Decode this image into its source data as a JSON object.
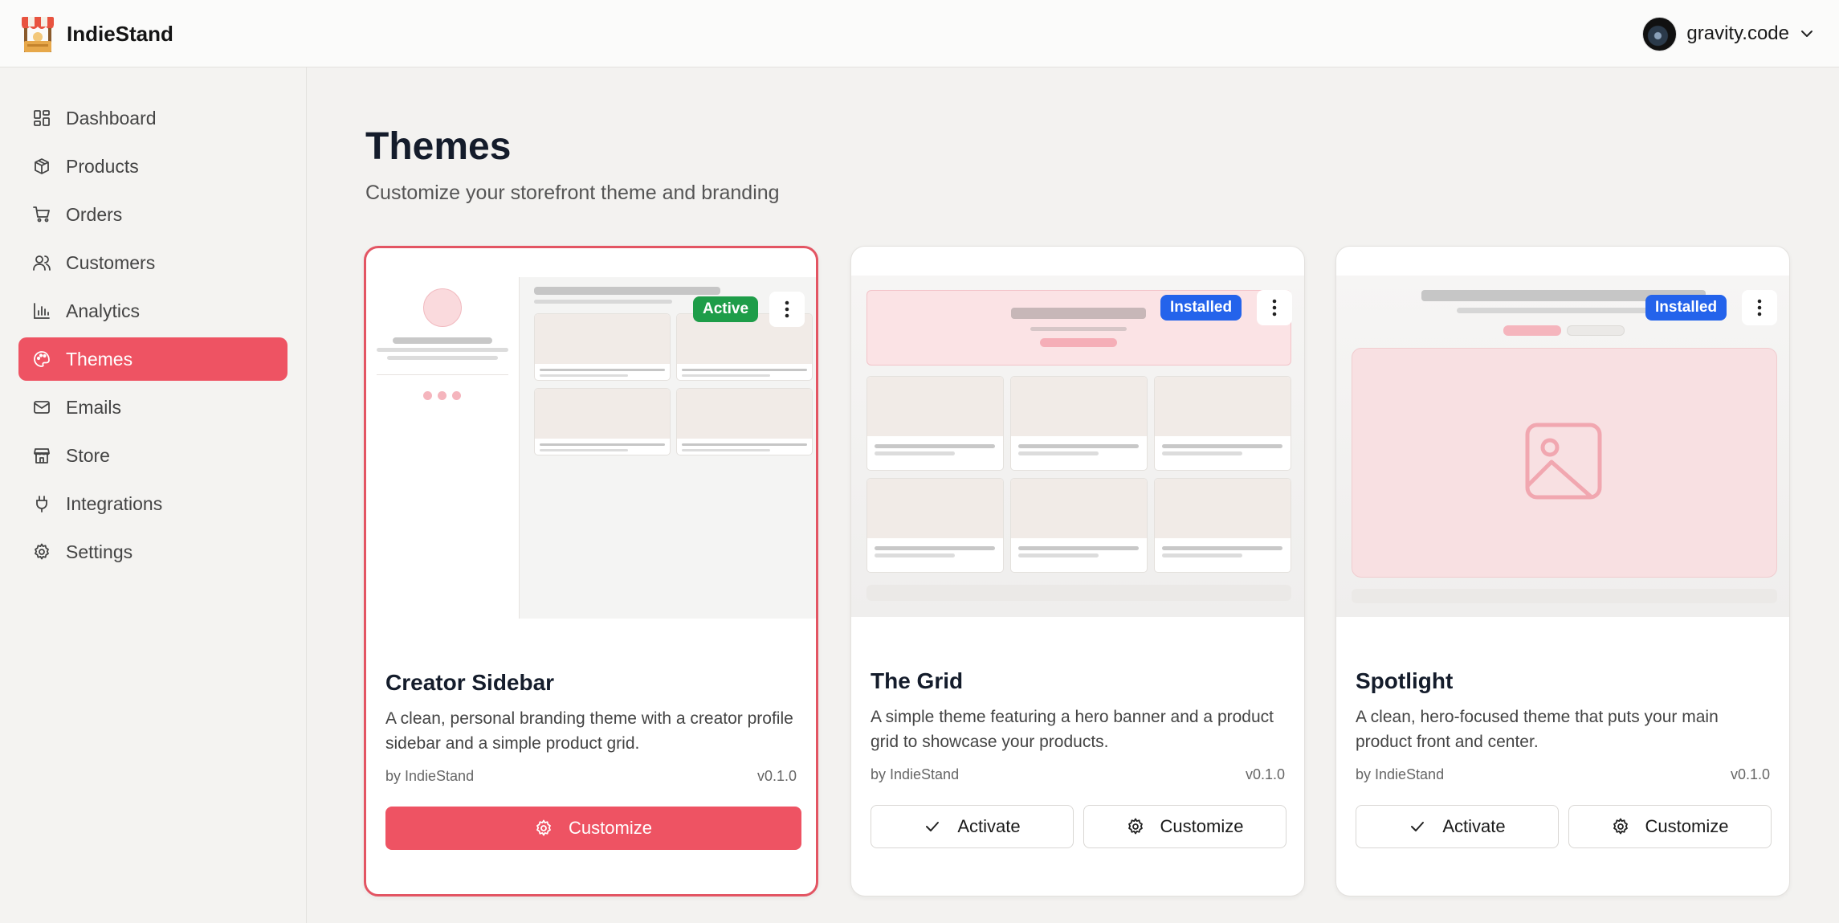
{
  "app": {
    "name": "IndieStand"
  },
  "user": {
    "name": "gravity.code"
  },
  "sidebar": {
    "items": [
      {
        "label": "Dashboard",
        "icon": "dashboard-icon"
      },
      {
        "label": "Products",
        "icon": "package-icon"
      },
      {
        "label": "Orders",
        "icon": "cart-icon"
      },
      {
        "label": "Customers",
        "icon": "users-icon"
      },
      {
        "label": "Analytics",
        "icon": "bar-chart-icon"
      },
      {
        "label": "Themes",
        "icon": "palette-icon",
        "active": true
      },
      {
        "label": "Emails",
        "icon": "mail-icon"
      },
      {
        "label": "Store",
        "icon": "store-icon"
      },
      {
        "label": "Integrations",
        "icon": "plug-icon"
      },
      {
        "label": "Settings",
        "icon": "gear-icon"
      }
    ]
  },
  "page": {
    "title": "Themes",
    "subtitle": "Customize your storefront theme and branding"
  },
  "themes": [
    {
      "name": "Creator Sidebar",
      "description": "A clean, personal branding theme with a creator profile sidebar and a simple product grid.",
      "author": "by IndieStand",
      "version": "v0.1.0",
      "badge": "Active",
      "customize_label": "Customize"
    },
    {
      "name": "The Grid",
      "description": "A simple theme featuring a hero banner and a product grid to showcase your products.",
      "author": "by IndieStand",
      "version": "v0.1.0",
      "badge": "Installed",
      "activate_label": "Activate",
      "customize_label": "Customize"
    },
    {
      "name": "Spotlight",
      "description": "A clean, hero-focused theme that puts your main product front and center.",
      "author": "by IndieStand",
      "version": "v0.1.0",
      "badge": "Installed",
      "activate_label": "Activate",
      "customize_label": "Customize"
    }
  ],
  "colors": {
    "accent": "#ee5363",
    "active_badge": "#1e9d49",
    "installed_badge": "#2463eb"
  }
}
